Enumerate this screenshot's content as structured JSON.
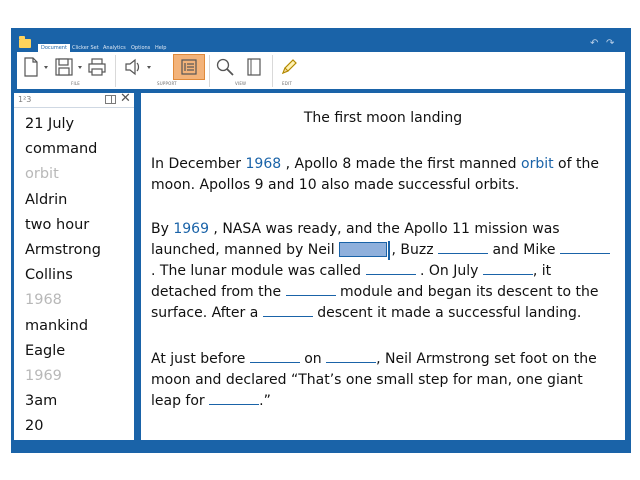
{
  "tabs": [
    {
      "label": "Document",
      "active": true
    },
    {
      "label": "Clicker Set",
      "active": false
    },
    {
      "label": "Analytics",
      "active": false
    },
    {
      "label": "Options",
      "active": false
    },
    {
      "label": "Help",
      "active": false
    }
  ],
  "ribbon": {
    "groups": {
      "file": "FILE",
      "support": "SUPPORT",
      "view": "VIEW",
      "edit": "EDIT"
    },
    "icons": [
      "new-document-icon",
      "save-icon",
      "print-icon",
      "speaker-icon",
      "word-bank-icon",
      "zoom-icon",
      "page-view-icon",
      "pencil-icon"
    ]
  },
  "sidebar": {
    "title": "1²3",
    "words": [
      {
        "text": "21 July",
        "used": false
      },
      {
        "text": "command",
        "used": false
      },
      {
        "text": "orbit",
        "used": true
      },
      {
        "text": "Aldrin",
        "used": false
      },
      {
        "text": "two hour",
        "used": false
      },
      {
        "text": "Armstrong",
        "used": false
      },
      {
        "text": "Collins",
        "used": false
      },
      {
        "text": "1968",
        "used": true
      },
      {
        "text": "mankind",
        "used": false
      },
      {
        "text": "Eagle",
        "used": false
      },
      {
        "text": "1969",
        "used": true
      },
      {
        "text": "3am",
        "used": false
      },
      {
        "text": "20",
        "used": false
      }
    ]
  },
  "document": {
    "title": "The first moon landing",
    "p1": {
      "t1": "In December ",
      "w1": "1968",
      "t2": " , Apollo 8 made the first manned ",
      "w2": "orbit",
      "t3": " of the moon.  Apollos 9 and 10 also made successful orbits."
    },
    "p2": {
      "t1": "By ",
      "w1": "1969",
      "t2": " , NASA was ready, and the Apollo 11 mission was launched, manned by Neil ",
      "t3": " , Buzz ",
      "t4": " and Mike ",
      "t5": " .  The lunar module was called ",
      "t6": " .  On July ",
      "t7": ", it detached from the ",
      "t8": " module and began its descent to the surface. After a ",
      "t9": " descent it made a successful landing."
    },
    "p3": {
      "t1": "At just before ",
      "t2": " on ",
      "t3": ", Neil Armstrong set foot on the moon and declared “That’s one small step for man, one giant leap for ",
      "t4": ".”"
    }
  },
  "colors": {
    "frame": "#1a63a8",
    "accent": "#1a63a8",
    "selected_tool": "#f3b37a",
    "used_word": "#b8b8b8"
  }
}
